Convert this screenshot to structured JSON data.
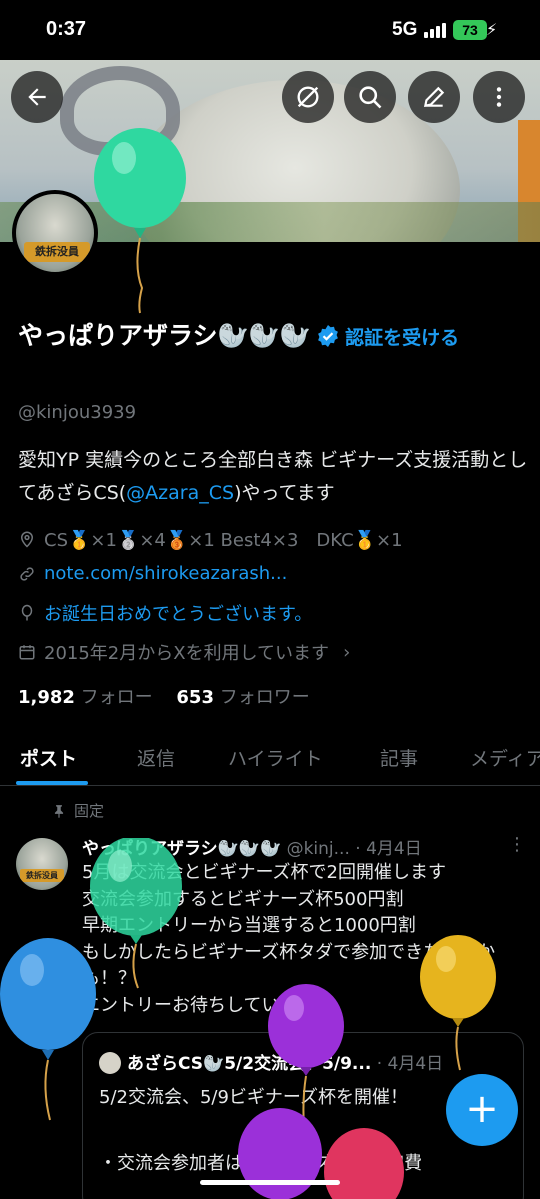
{
  "status": {
    "time": "0:37",
    "network": "5G",
    "battery": "73"
  },
  "header": {
    "back_icon": "back-arrow-icon",
    "actions": [
      "mute-icon",
      "search-icon",
      "edit-icon",
      "more-vertical-icon"
    ]
  },
  "avatar": {
    "tag": "鉄拆没員"
  },
  "profile": {
    "name": "やっぱりアザラシ🦭🦭🦭",
    "verify_link": "認証を受ける",
    "handle": "@kinjou3939",
    "bio_text_1": "愛知YP 実績今のところ全部白き森 ビギナーズ支援活動としてあざらCS(",
    "bio_mention": "@Azara_CS",
    "bio_text_2": ")やってます",
    "achievements": "CS🥇×1🥈×4🥉×1 Best4×3　DKC🥇×1",
    "website": "note.com/shirokeazarash...",
    "birthday": "お誕生日おめでとうございます。",
    "joined": "2015年2月からXを利用しています",
    "following_count": "1,982",
    "following_label": "フォロー",
    "followers_count": "653",
    "followers_label": "フォロワー"
  },
  "tabs": [
    "ポスト",
    "返信",
    "ハイライト",
    "記事",
    "メディア"
  ],
  "pinned_label": "固定",
  "post": {
    "name": "やっぱりアザラシ🦭🦭🦭",
    "handle": "@kinj...",
    "date": "4月4日",
    "lines": [
      "5月は交流会とビギナーズ杯で2回開催します",
      "交流会参加するとビギナーズ杯500円割",
      "早期エントリーから当選すると1000円割",
      "もしかしたらビギナーズ杯タダで参加できちゃうかも！？",
      "エントリーお待ちしています！"
    ]
  },
  "quote": {
    "name": "あざらCS🦭5/2交流会、5/9...",
    "date": "4月4日",
    "body": "5/2交流会、5/9ビギナーズ杯を開催！\n\n・交流会参加者はビギナーズ杯の参加費"
  },
  "fab": {
    "label": "+"
  },
  "colors": {
    "accent": "#1d9bf0",
    "background": "#000000",
    "muted": "#71767b"
  }
}
